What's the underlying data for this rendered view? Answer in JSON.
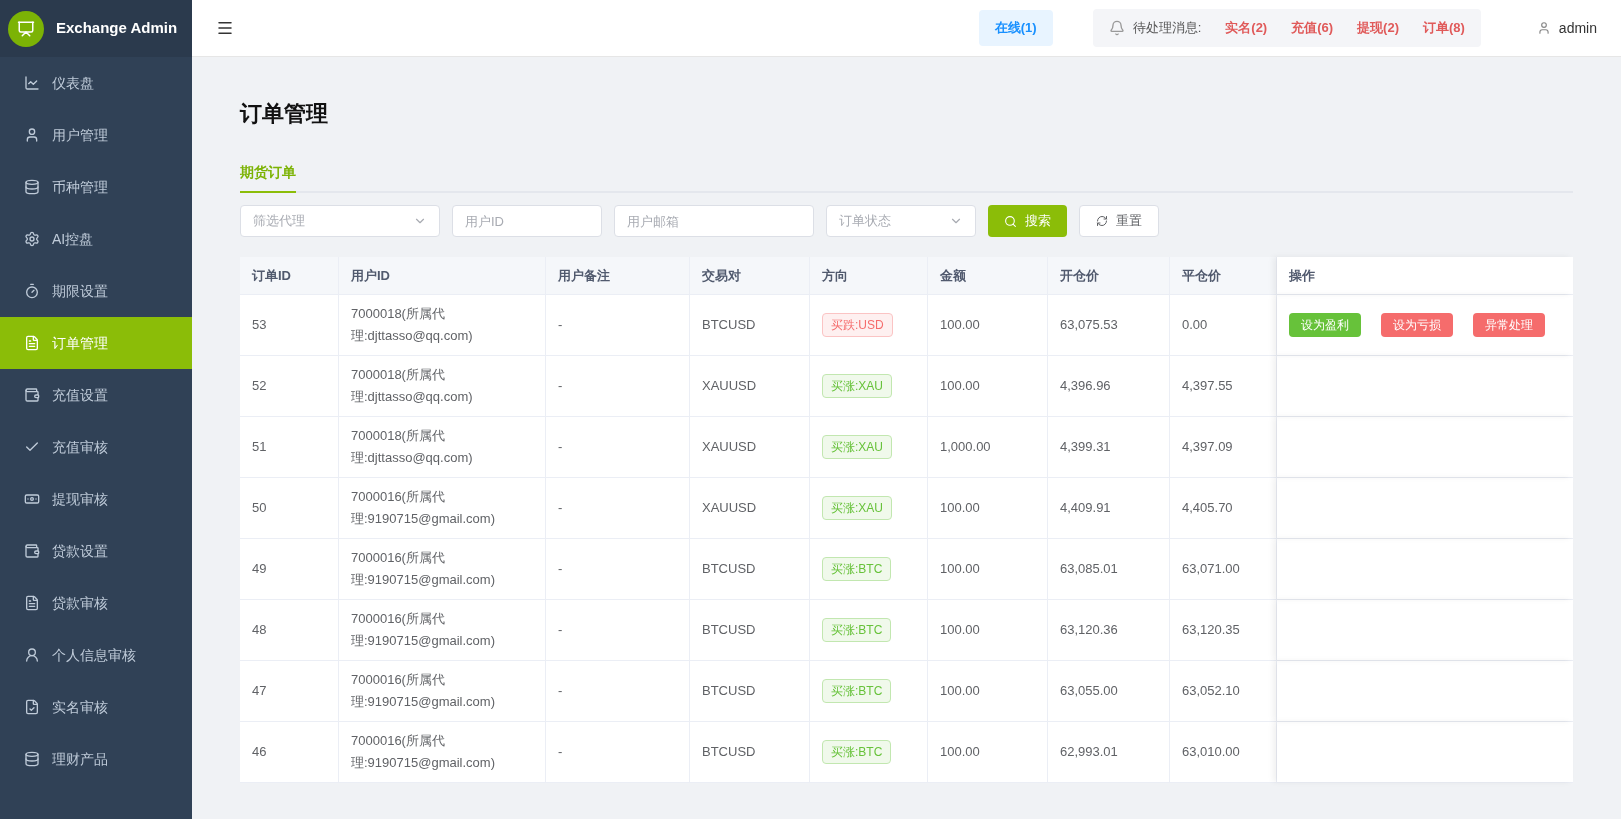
{
  "brand": "Exchange Admin",
  "sidebar": {
    "items": [
      {
        "label": "仪表盘",
        "selected": false
      },
      {
        "label": "用户管理",
        "selected": false
      },
      {
        "label": "币种管理",
        "selected": false
      },
      {
        "label": "AI控盘",
        "selected": false
      },
      {
        "label": "期限设置",
        "selected": false
      },
      {
        "label": "订单管理",
        "selected": true
      },
      {
        "label": "充值设置",
        "selected": false
      },
      {
        "label": "充值审核",
        "selected": false
      },
      {
        "label": "提现审核",
        "selected": false
      },
      {
        "label": "贷款设置",
        "selected": false
      },
      {
        "label": "贷款审核",
        "selected": false
      },
      {
        "label": "个人信息审核",
        "selected": false
      },
      {
        "label": "实名审核",
        "selected": false
      },
      {
        "label": "理财产品",
        "selected": false
      }
    ]
  },
  "header": {
    "online": "在线(1)",
    "pending_label": "待处理消息:",
    "pending": [
      "实名(2)",
      "充值(6)",
      "提现(2)",
      "订单(8)"
    ],
    "user": "admin"
  },
  "page": {
    "title": "订单管理",
    "tabs": [
      {
        "label": "期货订单",
        "selected": true
      }
    ],
    "filters": [
      {
        "kind": "select",
        "placeholder": "筛选代理"
      },
      {
        "kind": "input",
        "placeholder": "用户ID"
      },
      {
        "kind": "input",
        "placeholder": "用户邮箱"
      },
      {
        "kind": "select",
        "placeholder": "订单状态"
      }
    ],
    "search_button": "搜索",
    "reset_button": "重置"
  },
  "table": {
    "columns": [
      "订单ID",
      "用户ID",
      "用户备注",
      "交易对",
      "方向",
      "金额",
      "开仓价",
      "平仓价",
      "操作"
    ],
    "rows": [
      {
        "id": "53",
        "user": [
          "7000018(所属代",
          "理:djttasso@qq.com)"
        ],
        "note": "-",
        "pair": "BTCUSD",
        "direction": {
          "kind": "down",
          "label": "买跌:USD"
        },
        "amount": "100.00",
        "open": "63,075.53",
        "close": "0.00",
        "actions": [
          {
            "kind": "profit",
            "label": "设为盈利"
          },
          {
            "kind": "loss",
            "label": "设为亏损"
          },
          {
            "kind": "loss",
            "label": "异常处理"
          }
        ]
      },
      {
        "id": "52",
        "user": [
          "7000018(所属代",
          "理:djttasso@qq.com)"
        ],
        "note": "-",
        "pair": "XAUUSD",
        "direction": {
          "kind": "up",
          "label": "买涨:XAU"
        },
        "amount": "100.00",
        "open": "4,396.96",
        "close": "4,397.55"
      },
      {
        "id": "51",
        "user": [
          "7000018(所属代",
          "理:djttasso@qq.com)"
        ],
        "note": "-",
        "pair": "XAUUSD",
        "direction": {
          "kind": "up",
          "label": "买涨:XAU"
        },
        "amount": "1,000.00",
        "open": "4,399.31",
        "close": "4,397.09"
      },
      {
        "id": "50",
        "user": [
          "7000016(所属代",
          "理:9190715@gmail.com)"
        ],
        "note": "-",
        "pair": "XAUUSD",
        "direction": {
          "kind": "up",
          "label": "买涨:XAU"
        },
        "amount": "100.00",
        "open": "4,409.91",
        "close": "4,405.70"
      },
      {
        "id": "49",
        "user": [
          "7000016(所属代",
          "理:9190715@gmail.com)"
        ],
        "note": "-",
        "pair": "BTCUSD",
        "direction": {
          "kind": "up",
          "label": "买涨:BTC"
        },
        "amount": "100.00",
        "open": "63,085.01",
        "close": "63,071.00"
      },
      {
        "id": "48",
        "user": [
          "7000016(所属代",
          "理:9190715@gmail.com)"
        ],
        "note": "-",
        "pair": "BTCUSD",
        "direction": {
          "kind": "up",
          "label": "买涨:BTC"
        },
        "amount": "100.00",
        "open": "63,120.36",
        "close": "63,120.35"
      },
      {
        "id": "47",
        "user": [
          "7000016(所属代",
          "理:9190715@gmail.com)"
        ],
        "note": "-",
        "pair": "BTCUSD",
        "direction": {
          "kind": "up",
          "label": "买涨:BTC"
        },
        "amount": "100.00",
        "open": "63,055.00",
        "close": "63,052.10"
      },
      {
        "id": "46",
        "user": [
          "7000016(所属代",
          "理:9190715@gmail.com)"
        ],
        "note": "-",
        "pair": "BTCUSD",
        "direction": {
          "kind": "up",
          "label": "买涨:BTC"
        },
        "amount": "100.00",
        "open": "62,993.01",
        "close": "63,010.00"
      }
    ]
  }
}
